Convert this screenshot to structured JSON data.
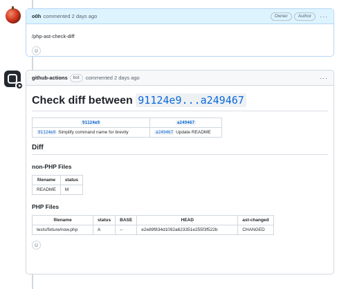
{
  "comment1": {
    "author": "o0h",
    "meta": "commented 2 days ago",
    "badges": [
      "Owner",
      "Author"
    ],
    "body": "/php-ast-check-diff"
  },
  "comment2": {
    "author": "github-actions",
    "bot_badge": "bot",
    "meta": "commented 2 days ago",
    "title_prefix": "Check diff between",
    "title_code": "91124e9...a249467",
    "commit_table": {
      "headers": [
        "91124e9",
        "a249467"
      ],
      "left_sha": "91124e9",
      "left_msg": "Simplify command name for brevity",
      "right_sha": "a249467",
      "right_msg": "Update README"
    },
    "diff_heading": "Diff",
    "nonphp_heading": "non-PHP Files",
    "nonphp_table": {
      "headers": [
        "filename",
        "status"
      ],
      "rows": [
        [
          "README",
          "M"
        ]
      ]
    },
    "php_heading": "PHP Files",
    "php_table": {
      "headers": [
        "filename",
        "status",
        "BASE",
        "HEAD",
        "ast-changed"
      ],
      "rows": [
        [
          "tests/fixture/now.php",
          "A",
          "--",
          "e2e89f834d1092a623351e255f3f522b",
          "CHANGED"
        ]
      ]
    }
  },
  "icons": {
    "reaction": "smiley-icon",
    "more": "kebab-icon"
  }
}
